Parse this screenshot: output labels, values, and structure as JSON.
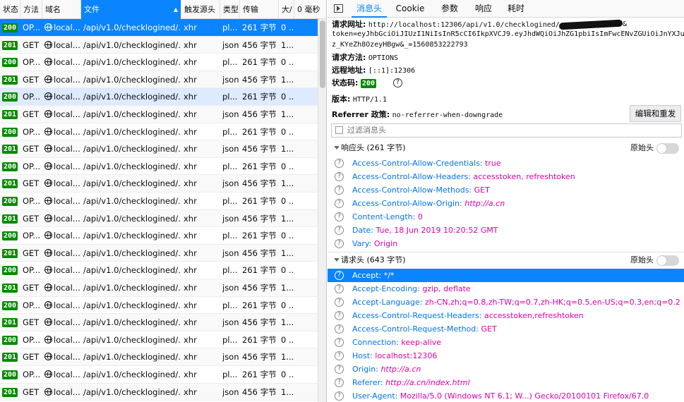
{
  "columns": [
    "状态",
    "方法",
    "域名",
    "文件",
    "触发源头",
    "类型",
    "传输",
    "大/",
    "0 毫秒"
  ],
  "rows": [
    {
      "status": "200",
      "method": "OP...",
      "domain": "local...",
      "file": "/api/v1.0/checklogined/...",
      "cause": "xhr",
      "type": "pl...",
      "transfer": "261 字节",
      "size": "0 ..."
    },
    {
      "status": "201",
      "method": "GET",
      "domain": "local...",
      "file": "/api/v1.0/checklogined/...",
      "cause": "xhr",
      "type": "json",
      "transfer": "456 字节",
      "size": "1..."
    },
    {
      "status": "200",
      "method": "OP...",
      "domain": "local...",
      "file": "/api/v1.0/checklogined/...",
      "cause": "xhr",
      "type": "pl...",
      "transfer": "261 字节",
      "size": "0 ..."
    },
    {
      "status": "201",
      "method": "GET",
      "domain": "local...",
      "file": "/api/v1.0/checklogined/...",
      "cause": "xhr",
      "type": "json",
      "transfer": "456 字节",
      "size": "1..."
    },
    {
      "status": "200",
      "method": "OP...",
      "domain": "local...",
      "file": "/api/v1.0/checklogined/...",
      "cause": "xhr",
      "type": "pl...",
      "transfer": "261 字节",
      "size": "0 ..."
    },
    {
      "status": "201",
      "method": "GET",
      "domain": "local...",
      "file": "/api/v1.0/checklogined/...",
      "cause": "xhr",
      "type": "json",
      "transfer": "456 字节",
      "size": "1..."
    },
    {
      "status": "200",
      "method": "OP...",
      "domain": "local...",
      "file": "/api/v1.0/checklogined/...",
      "cause": "xhr",
      "type": "pl...",
      "transfer": "261 字节",
      "size": "0 ..."
    },
    {
      "status": "201",
      "method": "GET",
      "domain": "local...",
      "file": "/api/v1.0/checklogined/...",
      "cause": "xhr",
      "type": "json",
      "transfer": "456 字节",
      "size": "1..."
    },
    {
      "status": "200",
      "method": "OP...",
      "domain": "local...",
      "file": "/api/v1.0/checklogined/...",
      "cause": "xhr",
      "type": "pl...",
      "transfer": "261 字节",
      "size": "0 ..."
    },
    {
      "status": "201",
      "method": "GET",
      "domain": "local...",
      "file": "/api/v1.0/checklogined/...",
      "cause": "xhr",
      "type": "json",
      "transfer": "456 字节",
      "size": "1..."
    },
    {
      "status": "200",
      "method": "OP...",
      "domain": "local...",
      "file": "/api/v1.0/checklogined/...",
      "cause": "xhr",
      "type": "pl...",
      "transfer": "261 字节",
      "size": "0 ..."
    },
    {
      "status": "201",
      "method": "GET",
      "domain": "local...",
      "file": "/api/v1.0/checklogined/...",
      "cause": "xhr",
      "type": "json",
      "transfer": "456 字节",
      "size": "1..."
    },
    {
      "status": "200",
      "method": "OP...",
      "domain": "local...",
      "file": "/api/v1.0/checklogined/...",
      "cause": "xhr",
      "type": "pl...",
      "transfer": "261 字节",
      "size": "0 ..."
    },
    {
      "status": "201",
      "method": "GET",
      "domain": "local...",
      "file": "/api/v1.0/checklogined/...",
      "cause": "xhr",
      "type": "json",
      "transfer": "456 字节",
      "size": "1..."
    },
    {
      "status": "200",
      "method": "OP...",
      "domain": "local...",
      "file": "/api/v1.0/checklogined/...",
      "cause": "xhr",
      "type": "pl...",
      "transfer": "261 字节",
      "size": "0 ..."
    },
    {
      "status": "201",
      "method": "GET",
      "domain": "local...",
      "file": "/api/v1.0/checklogined/...",
      "cause": "xhr",
      "type": "json",
      "transfer": "456 字节",
      "size": "1..."
    },
    {
      "status": "200",
      "method": "OP...",
      "domain": "local...",
      "file": "/api/v1.0/checklogined/...",
      "cause": "xhr",
      "type": "pl...",
      "transfer": "261 字节",
      "size": "0 ..."
    },
    {
      "status": "201",
      "method": "GET",
      "domain": "local...",
      "file": "/api/v1.0/checklogined/...",
      "cause": "xhr",
      "type": "json",
      "transfer": "456 字节",
      "size": "1..."
    },
    {
      "status": "200",
      "method": "OP...",
      "domain": "local...",
      "file": "/api/v1.0/checklogined/...",
      "cause": "xhr",
      "type": "pl...",
      "transfer": "261 字节",
      "size": "0 ..."
    },
    {
      "status": "201",
      "method": "GET",
      "domain": "local...",
      "file": "/api/v1.0/checklogined/...",
      "cause": "xhr",
      "type": "json",
      "transfer": "456 字节",
      "size": "1..."
    },
    {
      "status": "200",
      "method": "OP...",
      "domain": "local...",
      "file": "/api/v1.0/checklogined/...",
      "cause": "xhr",
      "type": "pl...",
      "transfer": "261 字节",
      "size": "0 ..."
    },
    {
      "status": "201",
      "method": "GET",
      "domain": "local...",
      "file": "/api/v1.0/checklogined/...",
      "cause": "xhr",
      "type": "json",
      "transfer": "456 字节",
      "size": "1..."
    }
  ],
  "tabs": [
    "消息头",
    "Cookie",
    "参数",
    "响应",
    "耗时"
  ],
  "details": {
    "url_label": "请求网址:",
    "url_line1": "http://localhost:12306/api/v1.0/checklogined/",
    "url_line1_tail": "&",
    "url_line2": "token=eyJhbGciOiJIUzI1NiIsInR5cCI6IkpXVCJ9.eyJhdWQiOiJhZG1pbiIsImFwcENvZGUiOiJnYXJu",
    "url_line3": "z_KYeZh8OzeyHBgw&_=1560853222793",
    "method_label": "请求方法:",
    "method": "OPTIONS",
    "remote_label": "远程地址:",
    "remote": "[::1]:12306",
    "status_label": "状态码:",
    "status": "200",
    "status_help": "?",
    "version_label": "版本:",
    "version": "HTTP/1.1",
    "referrer_label": "Referrer 政策:",
    "referrer": "no-referrer-when-downgrade",
    "edit_resend": "编辑和重发",
    "filter_placeholder": "过滤消息头"
  },
  "response_section": {
    "title": "响应头 (261 字节)",
    "raw": "原始头"
  },
  "response_headers": [
    {
      "k": "Access-Control-Allow-Credentials:",
      "v": "true"
    },
    {
      "k": "Access-Control-Allow-Headers:",
      "v": "accesstoken, refreshtoken"
    },
    {
      "k": "Access-Control-Allow-Methods:",
      "v": "GET"
    },
    {
      "k": "Access-Control-Allow-Origin:",
      "v": "http://a.cn",
      "italic": true
    },
    {
      "k": "Content-Length:",
      "v": "0"
    },
    {
      "k": "Date:",
      "v": "Tue, 18 Jun 2019 10:20:52 GMT"
    },
    {
      "k": "Vary:",
      "v": "Origin"
    }
  ],
  "request_section": {
    "title": "请求头 (643 字节)",
    "raw": "原始头"
  },
  "request_headers": [
    {
      "k": "Accept:",
      "v": "*/*",
      "selected": true
    },
    {
      "k": "Accept-Encoding:",
      "v": "gzip, deflate"
    },
    {
      "k": "Accept-Language:",
      "v": "zh-CN,zh;q=0.8,zh-TW;q=0.7,zh-HK;q=0.5,en-US;q=0.3,en;q=0.2"
    },
    {
      "k": "Access-Control-Request-Headers:",
      "v": "accesstoken,refreshtoken"
    },
    {
      "k": "Access-Control-Request-Method:",
      "v": "GET"
    },
    {
      "k": "Connection:",
      "v": "keep-alive"
    },
    {
      "k": "Host:",
      "v": "localhost:12306"
    },
    {
      "k": "Origin:",
      "v": "http://a.cn",
      "italic": true
    },
    {
      "k": "Referer:",
      "v": "http://a.cn/index.html",
      "italic": true
    },
    {
      "k": "User-Agent:",
      "v": "Mozilla/5.0 (Windows NT 6.1; W...) Gecko/20100101 Firefox/67.0"
    }
  ],
  "colors": {
    "accent": "#0a84ff",
    "ok": "#058b00",
    "key": "#0074e8",
    "value": "#dd00a9"
  }
}
